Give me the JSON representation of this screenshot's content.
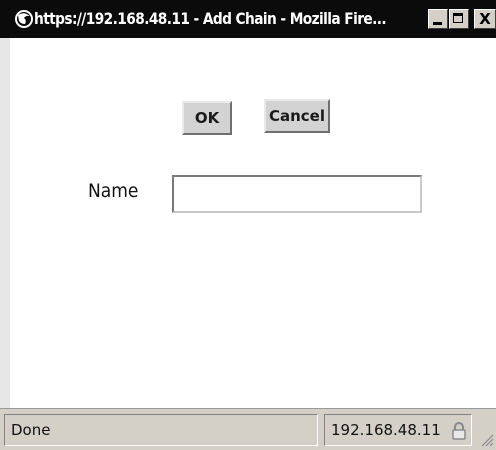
{
  "window": {
    "title": "https://192.168.48.11 - Add Chain - Mozilla Fire...",
    "app_icon": "firefox-icon",
    "controls": {
      "minimize": "_",
      "maximize": "□",
      "close": "X"
    }
  },
  "form": {
    "ok_label": "OK",
    "cancel_label": "Cancel",
    "name_label": "Name",
    "name_value": ""
  },
  "status": {
    "text": "Done",
    "host": "192.168.48.11",
    "lock_icon": "padlock-icon"
  },
  "colors": {
    "titlebar": "#0b0b0b",
    "chrome": "#d4d0c8",
    "button": "#d3d3d3"
  }
}
